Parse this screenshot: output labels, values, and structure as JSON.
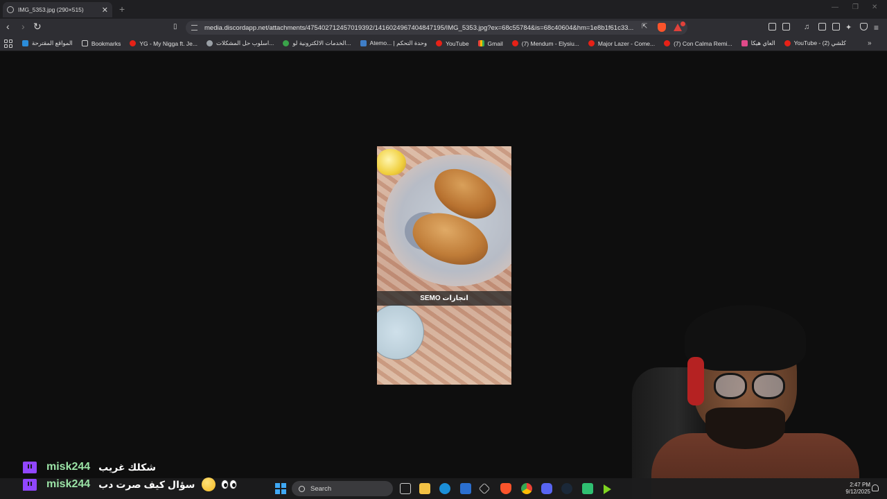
{
  "browser": {
    "tab": {
      "title": "IMG_5353.jpg (290×515)"
    },
    "url": "media.discordapp.net/attachments/475402712457019392/1416024967404847195/IMG_5353.jpg?ex=68c55784&is=68c40604&hm=1e8b1f61c33...",
    "bookmarks": [
      {
        "label": "المواقع المقترحة",
        "icon": "bing"
      },
      {
        "label": "Bookmarks",
        "icon": "bk"
      },
      {
        "label": "YG - My Nigga ft. Je...",
        "icon": "yt"
      },
      {
        "label": "اسلوب حل المشكلات...",
        "icon": "gl"
      },
      {
        "label": "الخدمات الالكترونية لو...",
        "icon": "gr"
      },
      {
        "label": "Atemo... | وحدة التحكم",
        "icon": "at"
      },
      {
        "label": "YouTube",
        "icon": "yt"
      },
      {
        "label": "Gmail",
        "icon": "gm"
      },
      {
        "label": "(7) Mendum - Elysiu...",
        "icon": "yt"
      },
      {
        "label": "Major Lazer - Come...",
        "icon": "yt"
      },
      {
        "label": "(7) Con Calma Remi...",
        "icon": "yt"
      },
      {
        "label": "العاي هيكا",
        "icon": "pk"
      },
      {
        "label": "YouTube - كلشي (2)",
        "icon": "yt"
      }
    ]
  },
  "image": {
    "caption": "SEMO انجازات"
  },
  "chat": [
    {
      "user": "misk244",
      "message": "شكلك غريب"
    },
    {
      "user": "misk244",
      "message": "سؤال كيف صرت دب"
    }
  ],
  "taskbar": {
    "search_label": "Search",
    "time": "2:47 PM",
    "date": "9/12/2025"
  }
}
